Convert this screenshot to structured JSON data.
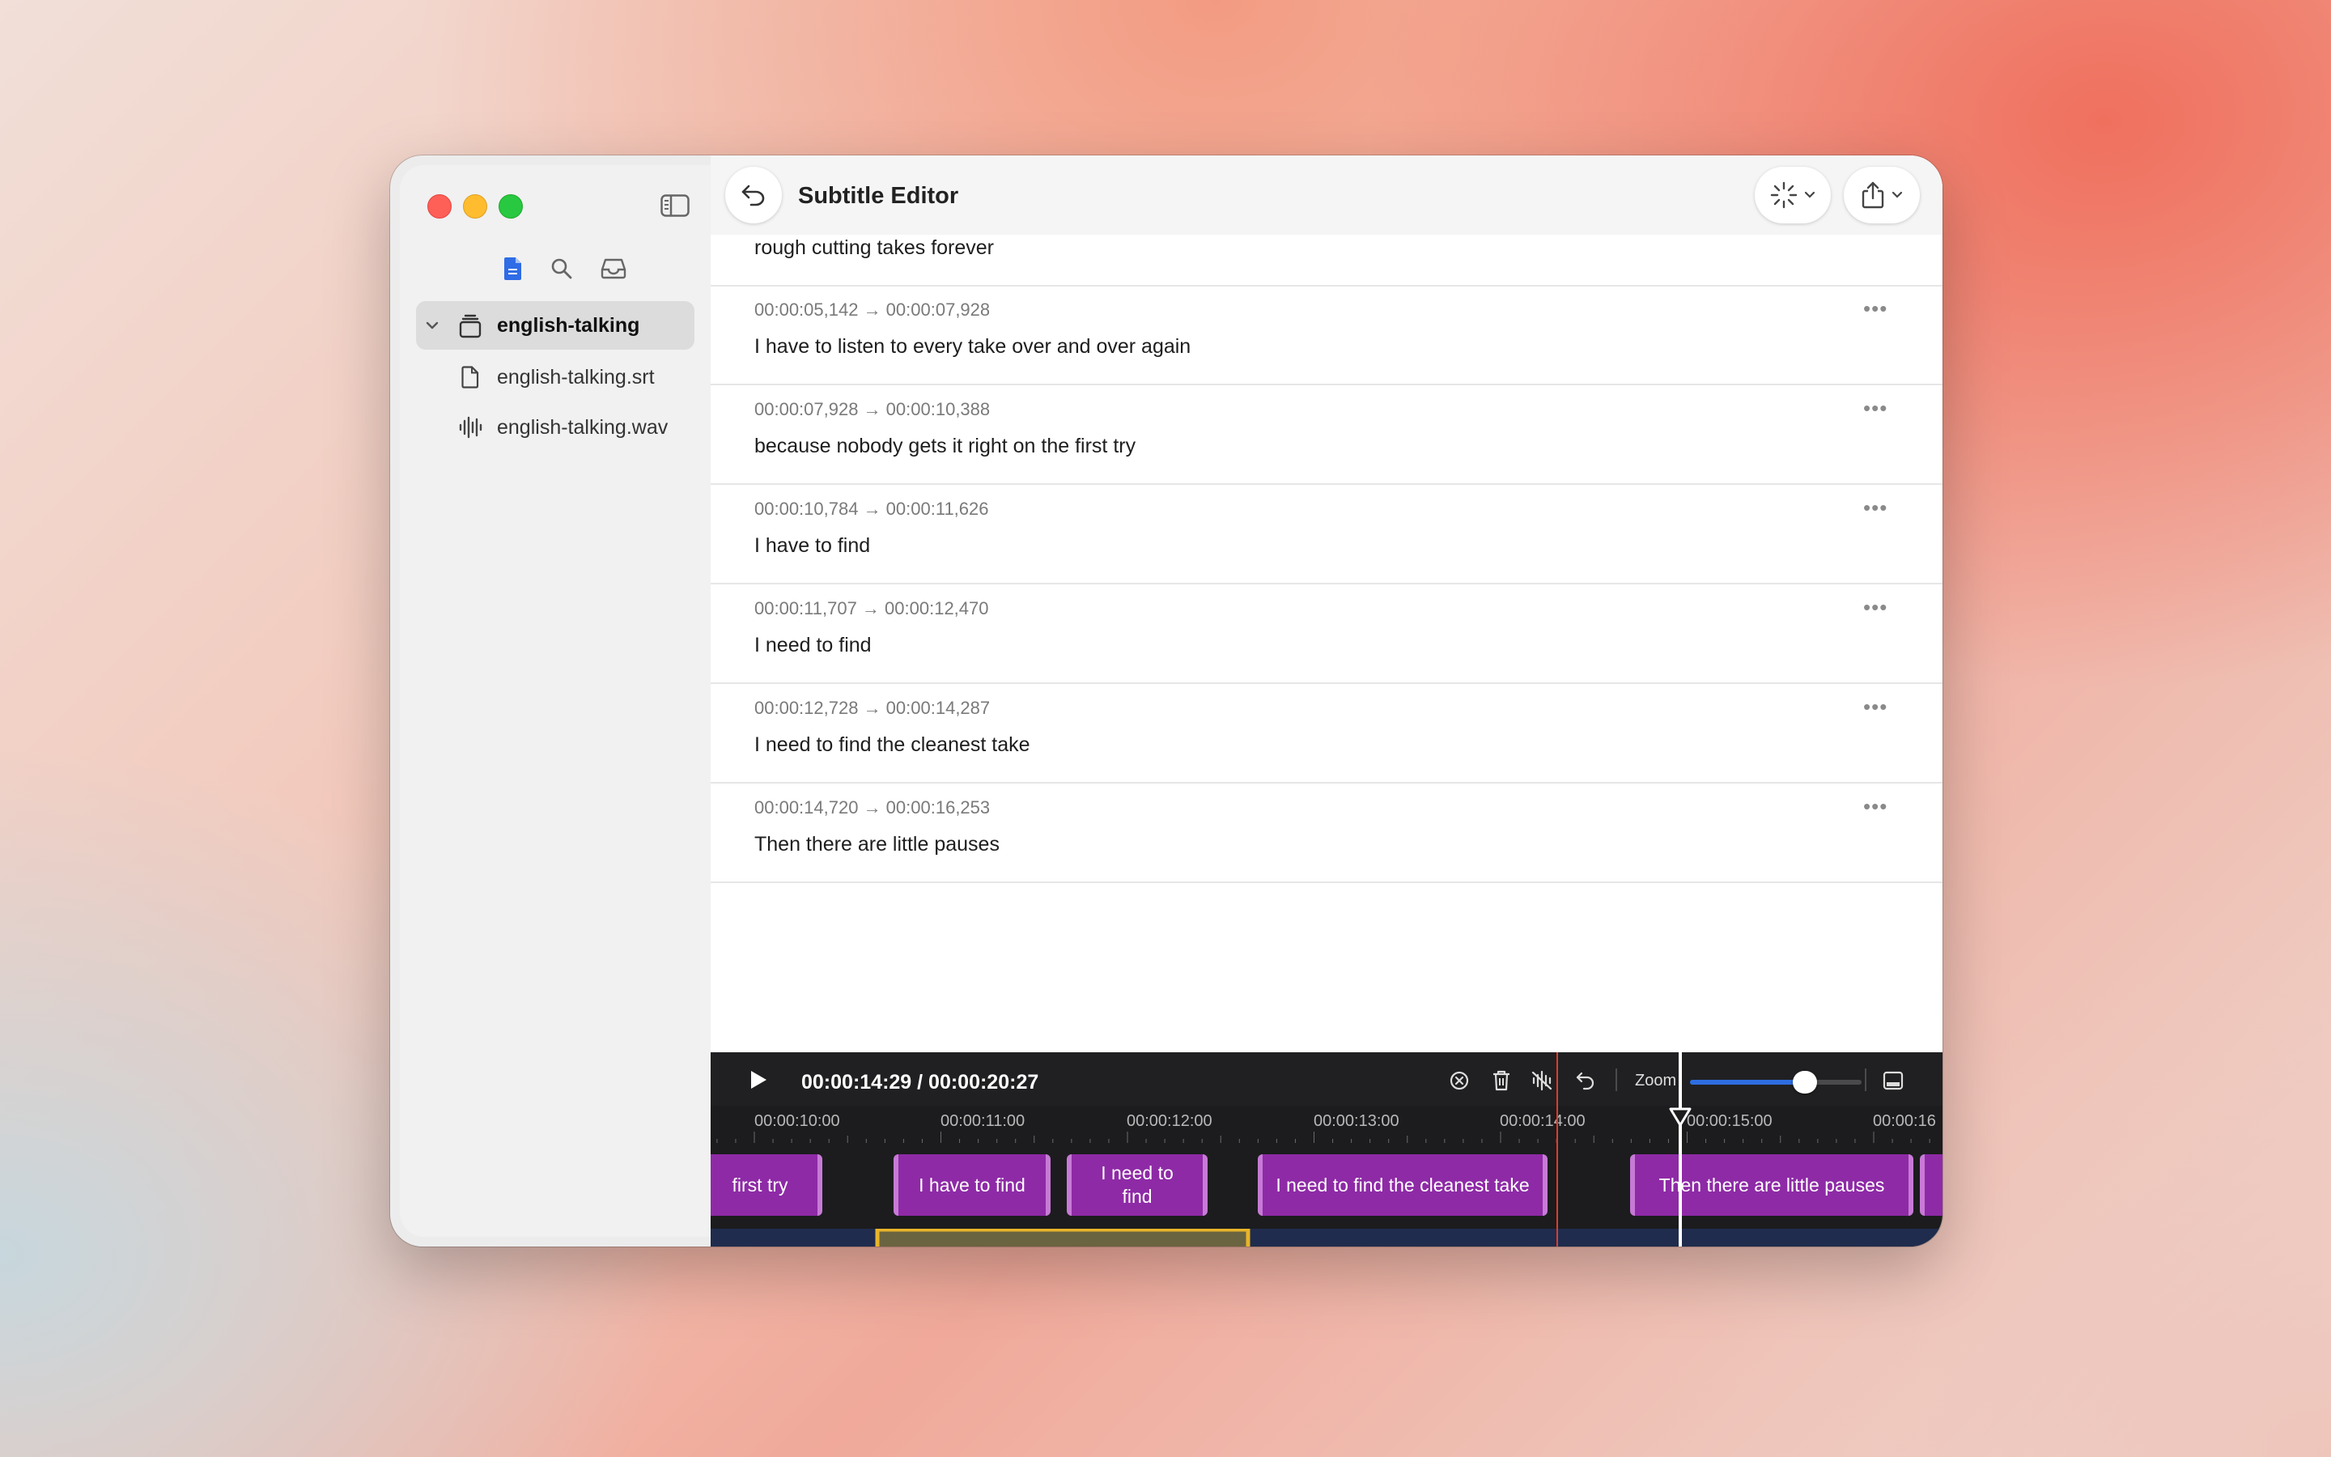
{
  "window": {
    "title": "Subtitle Editor"
  },
  "sidebar": {
    "tabs": [
      "file-icon",
      "search-icon",
      "inbox-icon"
    ],
    "project": {
      "name": "english-talking",
      "expanded": true
    },
    "files": [
      {
        "name": "english-talking.srt",
        "icon": "file-icon"
      },
      {
        "name": "english-talking.wav",
        "icon": "waveform-icon"
      }
    ]
  },
  "subtitles": [
    {
      "time": "",
      "text": "rough cutting takes forever"
    },
    {
      "time": "00:00:05,142 → 00:00:07,928",
      "text": "I have to listen to every take over and over again"
    },
    {
      "time": "00:00:07,928 → 00:00:10,388",
      "text": "because nobody gets it right on the first try"
    },
    {
      "time": "00:00:10,784 → 00:00:11,626",
      "text": "I have to find"
    },
    {
      "time": "00:00:11,707 → 00:00:12,470",
      "text": "I need to find"
    },
    {
      "time": "00:00:12,728 → 00:00:14,287",
      "text": "I need to find the cleanest take"
    },
    {
      "time": "00:00:14,720 → 00:00:16,253",
      "text": "Then there are little pauses"
    }
  ],
  "timeline": {
    "timecode": "00:00:14:29 / 00:00:20:27",
    "zoom_label": "Zoom",
    "zoom_level": 0.7,
    "ticks": [
      "00:00:10:00",
      "00:00:11:00",
      "00:00:12:00",
      "00:00:13:00",
      "00:00:14:00",
      "00:00:15:00",
      "00:00:16"
    ],
    "clips": [
      "first try",
      "I have to find",
      "I need to find",
      "I need to find the cleanest take",
      "Then there are little pauses"
    ],
    "colors": {
      "clip": "#8e2aa6",
      "selection": "#e8b52a",
      "waveform": "#7f94bd",
      "waveform_bg": "#1f2c4d",
      "zoom_accent": "#2e6de0"
    }
  }
}
